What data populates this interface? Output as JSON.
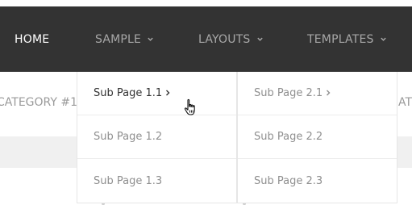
{
  "nav": {
    "items": [
      {
        "label": "HOME"
      },
      {
        "label": "SAMPLE"
      },
      {
        "label": "LAYOUTS"
      },
      {
        "label": "TEMPLATES"
      }
    ],
    "active_index": 0
  },
  "background": {
    "left_text": "CATEGORY #1",
    "right_text": "AT"
  },
  "dropdown_1": {
    "items": [
      {
        "label": "Sub Page 1.1"
      },
      {
        "label": "Sub Page 1.2"
      },
      {
        "label": "Sub Page 1.3"
      }
    ]
  },
  "dropdown_2": {
    "items": [
      {
        "label": "Sub Page 2.1"
      },
      {
        "label": "Sub Page 2.2"
      },
      {
        "label": "Sub Page 2.3"
      }
    ]
  },
  "icons": {
    "caret": "chevron-down-icon",
    "submenu": "chevron-right-icon",
    "cursor": "hand-pointer-icon"
  },
  "colors": {
    "navbar": "#333333",
    "nav_active": "#ffffff",
    "nav_inactive": "#a8a8a8",
    "submenu_text": "#8f8f8f",
    "submenu_hover_text": "#333333"
  }
}
